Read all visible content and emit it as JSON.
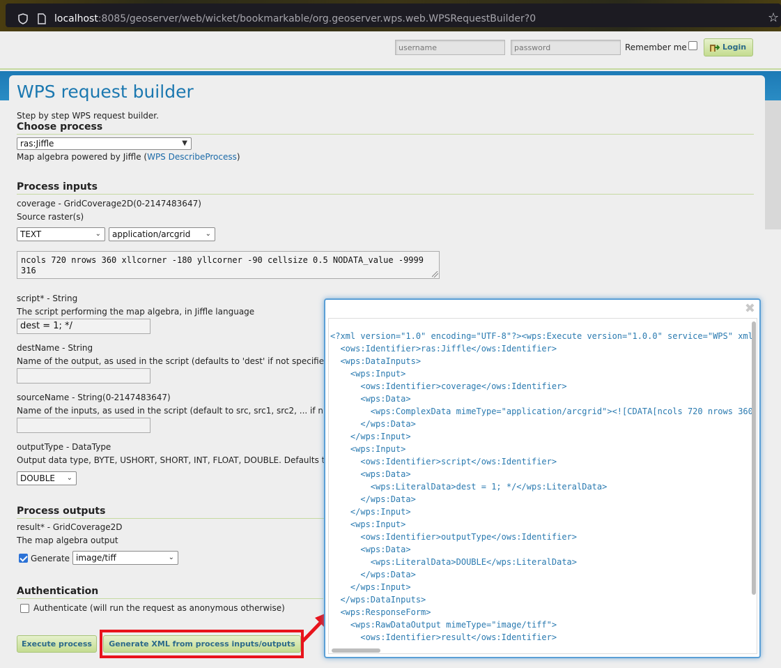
{
  "browser": {
    "url_host": "localhost",
    "url_rest": ":8085/geoserver/web/wicket/bookmarkable/org.geoserver.wps.web.WPSRequestBuilder?0"
  },
  "login": {
    "username_placeholder": "username",
    "password_placeholder": "password",
    "remember_label": "Remember me",
    "login_label": "Login"
  },
  "page": {
    "title": "WPS request builder",
    "subtitle": "Step by step WPS request builder."
  },
  "choose_process": {
    "heading": "Choose process",
    "selected": "ras:Jiffle",
    "description_prefix": "Map algebra powered by Jiffle (",
    "describe_link": "WPS DescribeProcess",
    "description_suffix": ")"
  },
  "process_inputs": {
    "heading": "Process inputs",
    "coverage": {
      "label": "coverage - GridCoverage2D(0-2147483647)",
      "description": "Source raster(s)",
      "type_selected": "TEXT",
      "mime_selected": "application/arcgrid",
      "value": "ncols 720 nrows 360 xllcorner -180 yllcorner -90 cellsize 0.5 NODATA_value -9999\n316"
    },
    "script": {
      "label": "script* - String",
      "description": "The script performing the map algebra, in Jiffle language",
      "value": "dest = 1; */"
    },
    "destName": {
      "label": "destName - String",
      "description": "Name of the output, as used in the script (defaults to 'dest' if not specifie",
      "value": ""
    },
    "sourceName": {
      "label": "sourceName - String(0-2147483647)",
      "description": "Name of the inputs, as used in the script (default to src, src1, src2, ... if n",
      "value": ""
    },
    "outputType": {
      "label": "outputType - DataType",
      "description": "Output data type, BYTE, USHORT, SHORT, INT, FLOAT, DOUBLE. Defaults t",
      "selected": "DOUBLE"
    }
  },
  "process_outputs": {
    "heading": "Process outputs",
    "result_label": "result* - GridCoverage2D",
    "result_description": "The map algebra output",
    "generate_label": "Generate",
    "generate_checked": true,
    "mime_selected": "image/tiff"
  },
  "authentication": {
    "heading": "Authentication",
    "checkbox_label": "Authenticate (will run the request as anonymous otherwise)",
    "checked": false
  },
  "actions": {
    "execute_label": "Execute process",
    "generate_xml_label": "Generate XML from process inputs/outputs"
  },
  "xml_popup": {
    "close_symbol": "✖",
    "lines": [
      "<?xml version=\"1.0\" encoding=\"UTF-8\"?><wps:Execute version=\"1.0.0\" service=\"WPS\" xml",
      "  <ows:Identifier>ras:Jiffle</ows:Identifier>",
      "  <wps:DataInputs>",
      "    <wps:Input>",
      "      <ows:Identifier>coverage</ows:Identifier>",
      "      <wps:Data>",
      "        <wps:ComplexData mimeType=\"application/arcgrid\"><![CDATA[ncols 720 nrows 360",
      "      </wps:Data>",
      "    </wps:Input>",
      "    <wps:Input>",
      "      <ows:Identifier>script</ows:Identifier>",
      "      <wps:Data>",
      "        <wps:LiteralData>dest = 1; */</wps:LiteralData>",
      "      </wps:Data>",
      "    </wps:Input>",
      "    <wps:Input>",
      "      <ows:Identifier>outputType</ows:Identifier>",
      "      <wps:Data>",
      "        <wps:LiteralData>DOUBLE</wps:LiteralData>",
      "      </wps:Data>",
      "    </wps:Input>",
      "  </wps:DataInputs>",
      "  <wps:ResponseForm>",
      "    <wps:RawDataOutput mimeType=\"image/tiff\">",
      "      <ows:Identifier>result</ows:Identifier>"
    ]
  },
  "colors": {
    "accent_blue": "#1b78b0",
    "button_green": "#c4dc90",
    "highlight_red": "#e8141c",
    "xml_text": "#2a7ab0"
  }
}
